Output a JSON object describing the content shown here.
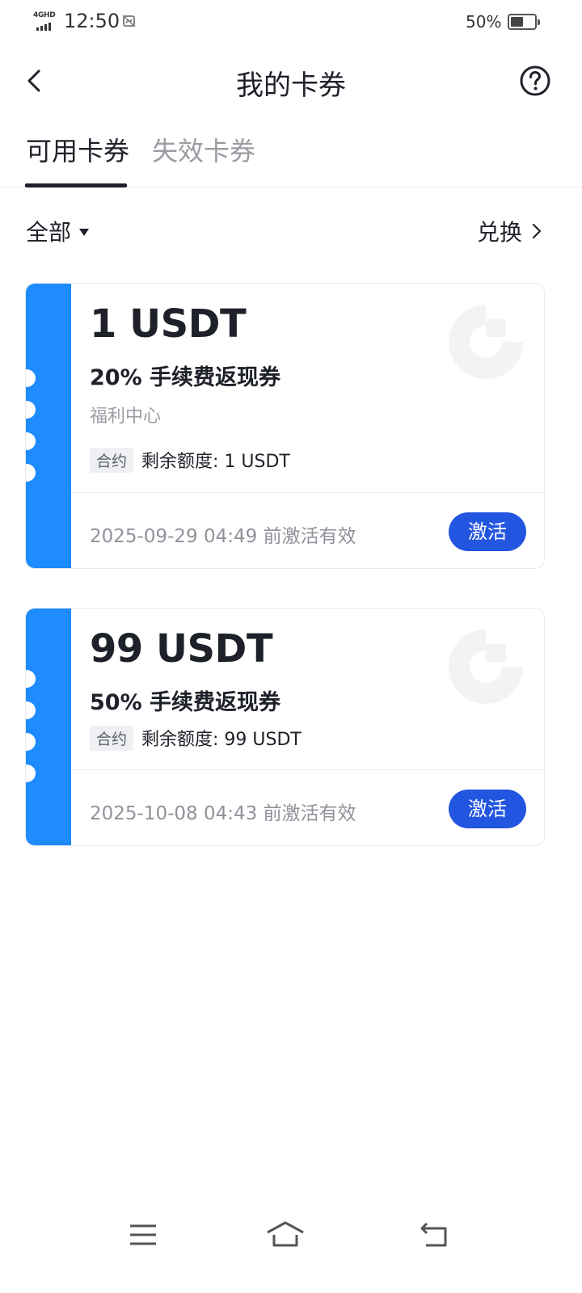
{
  "status_bar": {
    "network": "4GHD",
    "time": "12:50",
    "battery_percent": "50%",
    "battery_level": 0.5
  },
  "header": {
    "title": "我的卡券",
    "back_icon": "chevron-left-icon",
    "help_icon": "question-circle-icon"
  },
  "tabs": [
    {
      "label": "可用卡券",
      "active": true
    },
    {
      "label": "失效卡券",
      "active": false
    }
  ],
  "filter": {
    "all_label": "全部",
    "redeem_label": "兑换"
  },
  "coupons": [
    {
      "amount": "1 USDT",
      "name": "20% 手续费返现券",
      "source": "福利中心",
      "tag": "合约",
      "remaining": "剩余额度: 1 USDT",
      "expiry": "2025-09-29 04:49 前激活有效",
      "action": "激活"
    },
    {
      "amount": "99 USDT",
      "name": "50% 手续费返现券",
      "tag": "合约",
      "remaining": "剩余额度: 99 USDT",
      "expiry": "2025-10-08 04:43 前激活有效",
      "action": "激活"
    }
  ],
  "colors": {
    "stripe": "#1e8bff",
    "button": "#2255e0",
    "text": "#1e2129",
    "muted": "#9a9ca3"
  },
  "nav_bar": {
    "menu_icon": "menu-icon",
    "home_icon": "home-icon",
    "back_icon": "return-icon"
  }
}
